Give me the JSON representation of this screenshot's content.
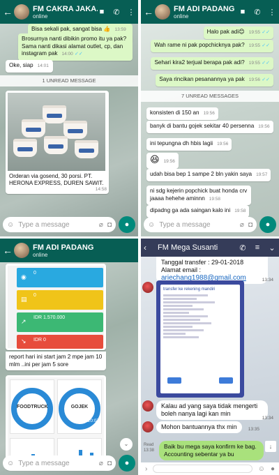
{
  "q1": {
    "title": "FM CAKRA JAKA...",
    "status": "online",
    "messages": [
      {
        "text": "Bisa sekali pak, sangat bisa 👍",
        "time": "13:59"
      },
      {
        "text": "Brosurnya nanti dibikin promo itu ya pak? Sama nanti dikasi alamat outlet, cp, dan instagram pak",
        "time": "14:00"
      },
      {
        "text": "Oke, siap",
        "time": "14:01"
      }
    ],
    "unread": "1 UNREAD MESSAGE",
    "photo_caption": "Orderan via gosend, 30 porsi. PT. HERONA EXPRESS, DUREN SAWIT.",
    "photo_time": "14:58",
    "placeholder": "Type a message"
  },
  "q2": {
    "title": "FM ADI PADANG",
    "status": "online",
    "out_messages": [
      {
        "text": "Halo pak adi😊",
        "time": "19:55"
      },
      {
        "text": "Wah rame ni pak popchicknya pak?",
        "time": "19:55"
      },
      {
        "text": "Sehari kira2 terjual berapa pak adi?",
        "time": "19:55"
      },
      {
        "text": "Saya rincikan pesanannya ya pak",
        "time": "19:56"
      }
    ],
    "unread": "7 UNREAD MESSAGES",
    "in_messages": [
      {
        "text": "konsisten di 150 an",
        "time": "19:56"
      },
      {
        "text": "banyk di bantu gojek sekitar 40 persenna",
        "time": "19:56"
      },
      {
        "text": "ini tepungna dh hbis lagii",
        "time": "19:56"
      },
      {
        "text": "😆",
        "time": "19:56"
      },
      {
        "text": "udah bisa bep 1 sampe 2 bln yakin saya",
        "time": "19:57"
      },
      {
        "text": "ni sdg kejerin popchick buat honda crv jaaaa hehehe aminnn",
        "time": "19:58"
      },
      {
        "text": "dipadng ga ada saingan kalo ini",
        "time": "19:58"
      }
    ],
    "placeholder": "Type a message"
  },
  "q3": {
    "title": "FM ADI PADANG",
    "status": "online",
    "fincards": [
      {
        "label": "0",
        "sub": "",
        "color": "#29a9e0"
      },
      {
        "label": "0",
        "sub": "",
        "color": "#f0c419"
      },
      {
        "label": "IDR 1.570.000",
        "sub": "",
        "color": "#3cb874"
      },
      {
        "label": "IDR 0",
        "sub": "",
        "color": "#e74c3c"
      }
    ],
    "caption": "report hari ini start jam 2 mpe jam 10 mlm ..ini per jam 5 sore",
    "gauge1": "FOODTRUCK",
    "gauge2": "GOJEK",
    "time": "20:07",
    "placeholder": "Type a message"
  },
  "q4": {
    "title": "FM Mega Susanti",
    "transfer_label": "Tanggal transfer : 29-01-2018",
    "email_label": "Alamat email :",
    "email": "ariechang1988@gmail.com",
    "time1": "13:34",
    "screenshot_title": "transfer ke rekening mandiri",
    "msg1": "Kalau ad yang saya tidak mengerti boleh nanya lagi kan min",
    "time2": "13:34",
    "msg2": "Mohon bantuannya thx min",
    "time3": "13:35",
    "read_label": "Read",
    "time4": "13:38",
    "reply": "Baik bu mega saya konfirm ke bag. Accounting sebentar ya bu"
  }
}
